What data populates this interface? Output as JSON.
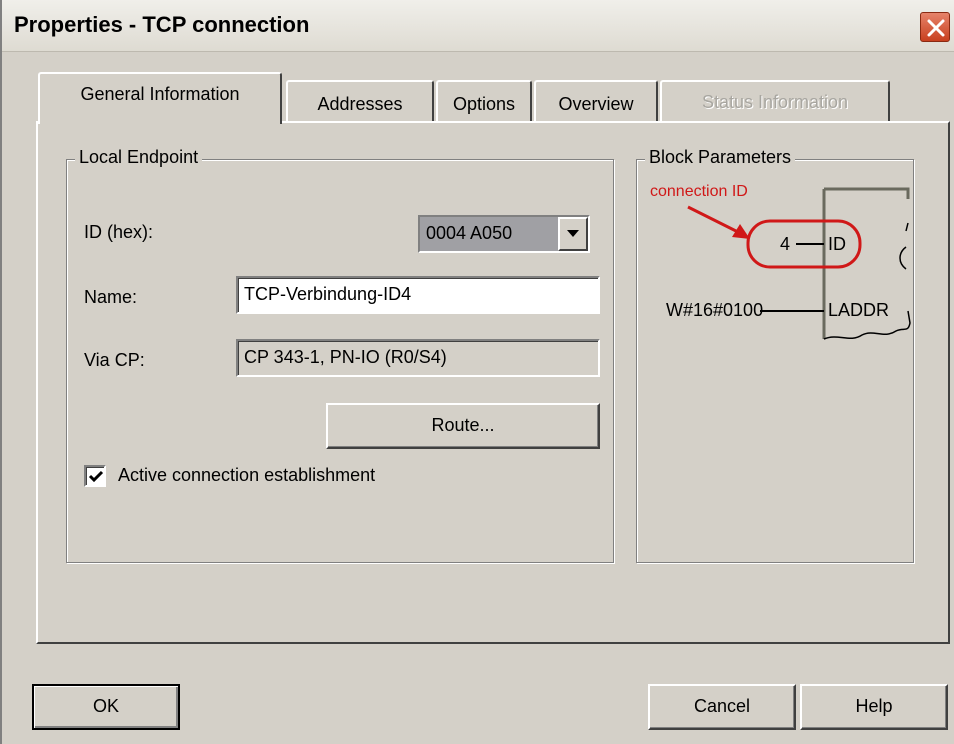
{
  "window": {
    "title": "Properties - TCP connection"
  },
  "tabs": [
    {
      "label": "General Information",
      "state": "active"
    },
    {
      "label": "Addresses",
      "state": "normal"
    },
    {
      "label": "Options",
      "state": "normal"
    },
    {
      "label": "Overview",
      "state": "normal"
    },
    {
      "label": "Status Information",
      "state": "disabled"
    }
  ],
  "local_endpoint": {
    "group_label": "Local Endpoint",
    "id_label": "ID (hex):",
    "id_value": "0004 A050",
    "name_label": "Name:",
    "name_value": "TCP-Verbindung-ID4",
    "via_cp_label": "Via CP:",
    "via_cp_value": "CP 343-1, PN-IO (R0/S4)",
    "route_button": "Route...",
    "active_connection_label": "Active connection establishment",
    "active_connection_checked": true
  },
  "block_parameters": {
    "group_label": "Block Parameters",
    "annotation": "connection ID",
    "id_param_value": "4",
    "id_param_name": "ID",
    "laddr_param_value": "W#16#0100",
    "laddr_param_name": "LADDR",
    "annotation_color": "#d01818"
  },
  "footer": {
    "ok_button": "OK",
    "cancel_button": "Cancel",
    "help_button": "Help"
  },
  "colors": {
    "face": "#d4d0c8",
    "highlight": "#ffffff",
    "shadow": "#808080",
    "dark_shadow": "#404040",
    "combo_selection": "#a0a0a4",
    "close_button": "#d4502c"
  }
}
